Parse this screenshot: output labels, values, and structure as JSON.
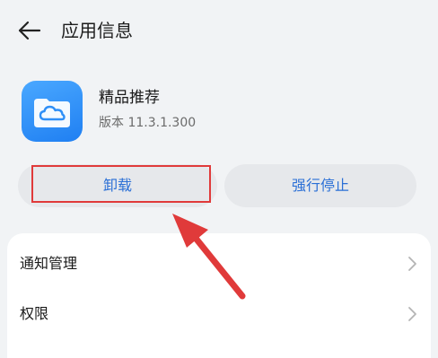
{
  "header": {
    "title": "应用信息",
    "back_icon": "arrow-left-icon"
  },
  "app": {
    "name": "精品推荐",
    "version": "版本 11.3.1.300",
    "icon": "cloud-folder-icon",
    "icon_color": "#2f8ff7"
  },
  "actions": {
    "uninstall_label": "卸载",
    "force_stop_label": "强行停止",
    "label_color": "#2a6fd6"
  },
  "settings": {
    "items": [
      {
        "label": "通知管理",
        "icon": "chevron-right-icon"
      },
      {
        "label": "权限",
        "icon": "chevron-right-icon"
      }
    ]
  },
  "annotation": {
    "highlight_color": "#e03a3a",
    "arrow_color": "#e03a3a"
  }
}
